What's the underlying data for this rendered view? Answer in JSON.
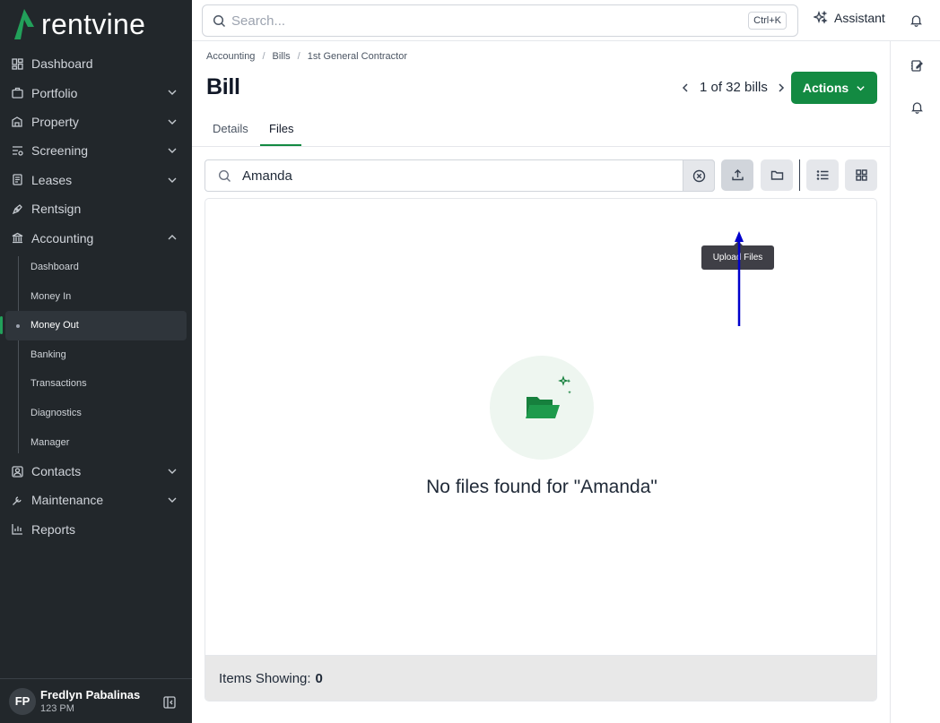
{
  "brand": {
    "logo_text": "rentvine",
    "accent": "#138a42"
  },
  "topbar": {
    "search_placeholder": "Search...",
    "shortcut": "Ctrl+K",
    "assistant_label": "Assistant"
  },
  "sidebar": {
    "items": [
      {
        "label": "Dashboard",
        "icon": "dashboard-icon"
      },
      {
        "label": "Portfolio",
        "icon": "portfolio-icon",
        "expandable": true
      },
      {
        "label": "Property",
        "icon": "property-icon",
        "expandable": true
      },
      {
        "label": "Screening",
        "icon": "screening-icon",
        "expandable": true
      },
      {
        "label": "Leases",
        "icon": "leases-icon",
        "expandable": true
      },
      {
        "label": "Rentsign",
        "icon": "rentsign-icon"
      },
      {
        "label": "Accounting",
        "icon": "accounting-icon",
        "expanded": true
      }
    ],
    "accounting_sub": [
      {
        "label": "Dashboard"
      },
      {
        "label": "Money In"
      },
      {
        "label": "Money Out",
        "active": true
      },
      {
        "label": "Banking"
      },
      {
        "label": "Transactions"
      },
      {
        "label": "Diagnostics"
      },
      {
        "label": "Manager"
      }
    ],
    "items_after": [
      {
        "label": "Contacts",
        "icon": "contacts-icon",
        "expandable": true
      },
      {
        "label": "Maintenance",
        "icon": "maintenance-icon",
        "expandable": true
      },
      {
        "label": "Reports",
        "icon": "reports-icon"
      }
    ],
    "user": {
      "initials": "FP",
      "name": "Fredlyn Pabalinas",
      "time": "123 PM"
    }
  },
  "breadcrumb": [
    "Accounting",
    "Bills",
    "1st General Contractor"
  ],
  "page": {
    "title": "Bill",
    "pager_text": "1 of 32 bills",
    "actions_label": "Actions"
  },
  "tabs": [
    {
      "label": "Details"
    },
    {
      "label": "Files",
      "active": true
    }
  ],
  "files": {
    "search_value": "Amanda",
    "tooltip": "Upload Files",
    "empty_message": "No files found for \"Amanda\"",
    "footer_label": "Items Showing:",
    "footer_count": "0"
  }
}
